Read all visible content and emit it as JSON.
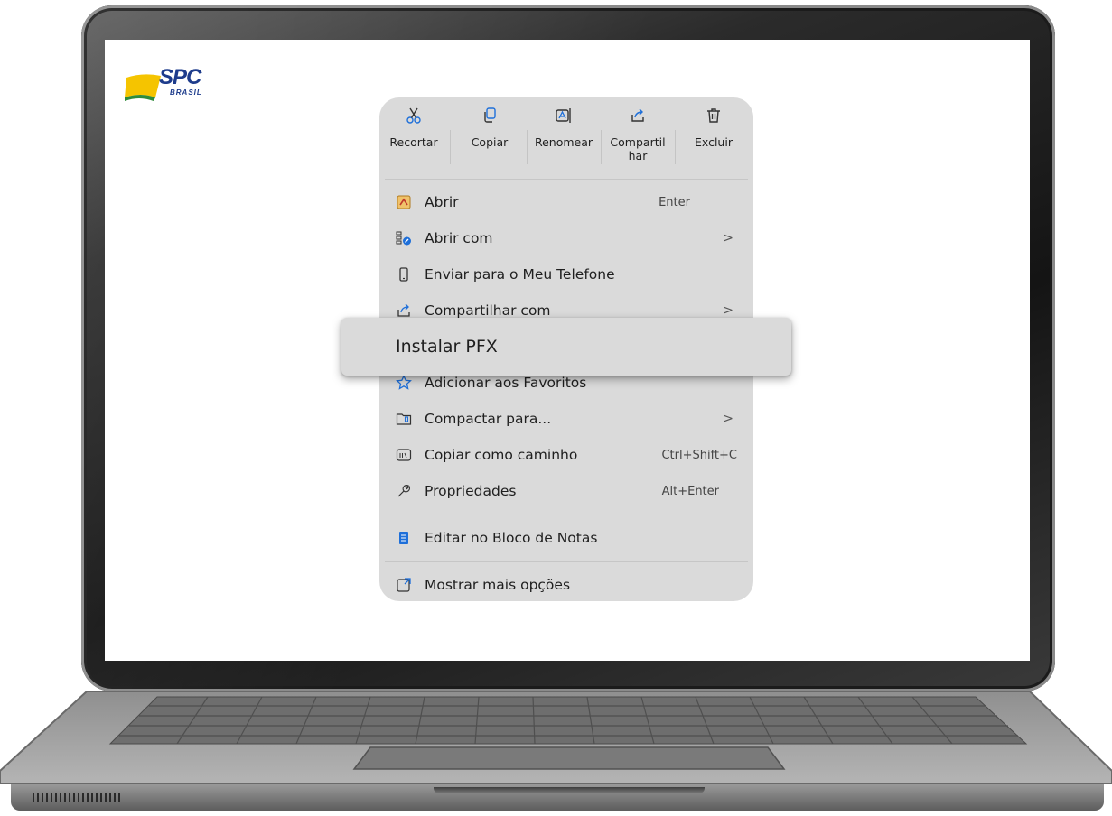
{
  "logo": {
    "brand": "SPC",
    "sub": "BRASIL"
  },
  "toolbar": [
    {
      "label": "Recortar",
      "icon": "scissors-icon"
    },
    {
      "label": "Copiar",
      "icon": "copy-icon"
    },
    {
      "label": "Renomear",
      "icon": "rename-icon"
    },
    {
      "label_line1": "Compartil",
      "label_line2": "har",
      "icon": "share-icon"
    },
    {
      "label": "Excluir",
      "icon": "trash-icon"
    }
  ],
  "items": {
    "abrir": {
      "label": "Abrir",
      "shortcut": "Enter",
      "icon": "open-icon"
    },
    "abrir_com": {
      "label": "Abrir com",
      "chevron": ">",
      "icon": "open-with-icon"
    },
    "enviar": {
      "label": "Enviar para o Meu Telefone",
      "icon": "phone-icon"
    },
    "compartilhar_com": {
      "label": "Compartilhar com",
      "chevron": ">",
      "icon": "share-icon"
    },
    "favoritos": {
      "label": "Adicionar aos Favoritos",
      "icon": "star-icon"
    },
    "compactar": {
      "label": "Compactar para...",
      "chevron": ">",
      "icon": "zip-folder-icon"
    },
    "copiar_caminho": {
      "label": "Copiar como caminho",
      "shortcut": "Ctrl+Shift+C",
      "icon": "path-icon"
    },
    "propriedades": {
      "label": "Propriedades",
      "shortcut": "Alt+Enter",
      "icon": "wrench-icon"
    },
    "bloco_notas": {
      "label": "Editar no Bloco de Notas",
      "icon": "notepad-icon"
    },
    "mais_opcoes": {
      "label": "Mostrar mais opções",
      "icon": "more-options-icon"
    }
  },
  "highlight": {
    "label": "Instalar PFX"
  },
  "colors": {
    "menu_bg": "#dadada",
    "accent": "#1e6fd9",
    "logo_blue": "#1e3c8c",
    "logo_yellow": "#f5c400"
  }
}
